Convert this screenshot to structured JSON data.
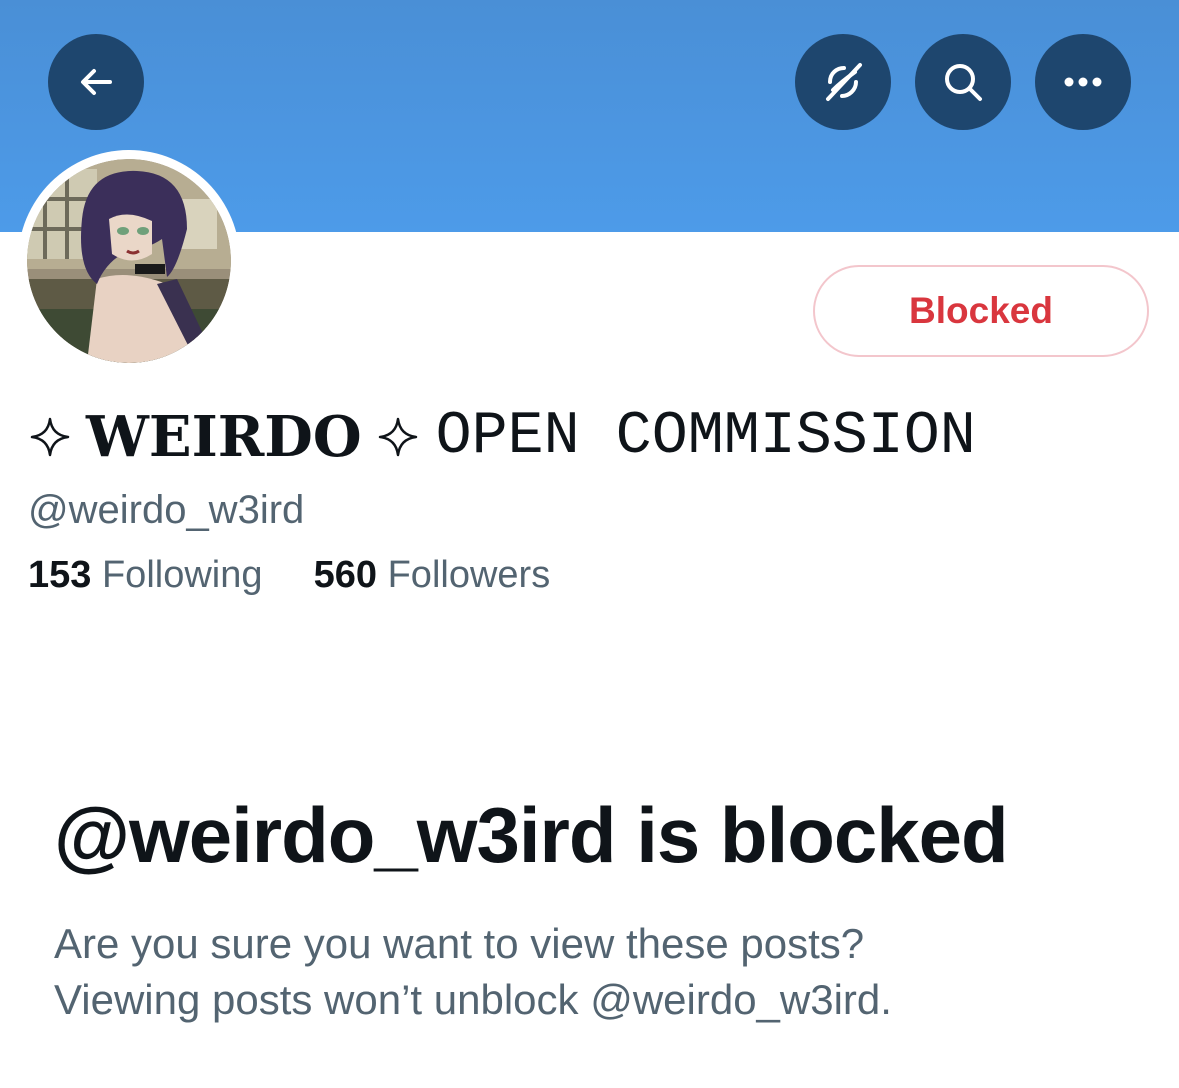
{
  "header": {
    "back_icon": "arrow-left-icon",
    "icons": [
      "satellite-off-icon",
      "search-icon",
      "more-icon"
    ],
    "banner_color": "#4d9be9",
    "button_color": "#1e466e"
  },
  "profile": {
    "blocked_button_label": "Blocked",
    "name_bold": "WEIRDO",
    "name_mono": "OPEN COMMISSION",
    "handle": "@weirdo_w3ird",
    "following_count": "153",
    "following_label": "Following",
    "followers_count": "560",
    "followers_label": "Followers"
  },
  "blocked_notice": {
    "title": "@weirdo_w3ird is blocked",
    "line1": "Are you sure you want to view these posts?",
    "line2": "Viewing posts won’t unblock @weirdo_w3ird."
  },
  "colors": {
    "blocked_red": "#d9363e",
    "text_primary": "#0f1419",
    "text_secondary": "#536471"
  }
}
